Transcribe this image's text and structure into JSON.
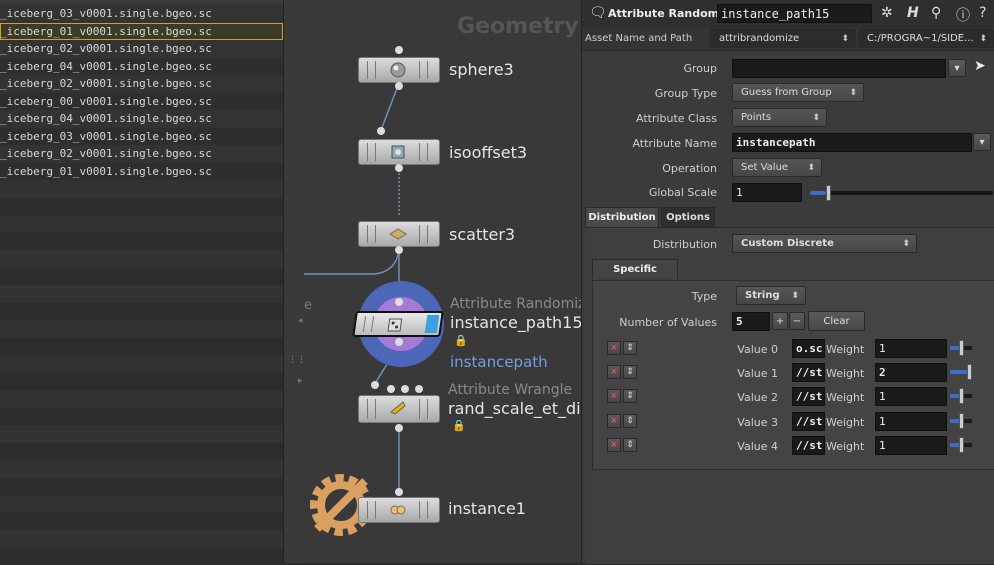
{
  "file_list": {
    "rows": [
      "_iceberg_03_v0001.single.bgeo.sc",
      "_iceberg_01_v0001.single.bgeo.sc",
      "_iceberg_02_v0001.single.bgeo.sc",
      "_iceberg_04_v0001.single.bgeo.sc",
      "_iceberg_02_v0001.single.bgeo.sc",
      "_iceberg_00_v0001.single.bgeo.sc",
      "_iceberg_04_v0001.single.bgeo.sc",
      "_iceberg_03_v0001.single.bgeo.sc",
      "_iceberg_02_v0001.single.bgeo.sc",
      "_iceberg_01_v0001.single.bgeo.sc"
    ],
    "selected_index": 1
  },
  "network": {
    "context_label": "Geometry",
    "side_letter": "e",
    "nodes": [
      {
        "name": "sphere3",
        "type": "",
        "icon": "sphere-icon"
      },
      {
        "name": "isooffset3",
        "type": "",
        "icon": "isooffset-icon"
      },
      {
        "name": "scatter3",
        "type": "",
        "icon": "scatter-icon"
      },
      {
        "name": "instance_path15",
        "type": "Attribute Randomize",
        "icon": "attribute-randomize-icon",
        "sublabel": "instancepath"
      },
      {
        "name": "rand_scale_et_dir",
        "type": "Attribute Wrangle",
        "icon": "wrangle-icon"
      },
      {
        "name": "instance1",
        "type": "",
        "icon": "instance-icon"
      }
    ]
  },
  "params": {
    "title": {
      "type_name": "Attribute Randomize",
      "node_name": "instance_path15"
    },
    "asset": {
      "label": "Asset Name and Path",
      "name": "attribrandomize",
      "path": "C:/PROGRA~1/SIDE..."
    },
    "group": {
      "label": "Group",
      "value": ""
    },
    "group_type": {
      "label": "Group Type",
      "value": "Guess from Group"
    },
    "attribute_class": {
      "label": "Attribute Class",
      "value": "Points"
    },
    "attribute_name": {
      "label": "Attribute Name",
      "value": "instancepath"
    },
    "operation": {
      "label": "Operation",
      "value": "Set Value"
    },
    "global_scale": {
      "label": "Global Scale",
      "value": "1",
      "slider_fraction": 0.09
    },
    "tabs": [
      "Distribution",
      "Options"
    ],
    "distribution": {
      "label": "Distribution",
      "value": "Custom Discrete"
    },
    "subtab": "Specific Values",
    "type": {
      "label": "Type",
      "value": "String"
    },
    "num_values": {
      "label": "Number of Values",
      "value": "5",
      "clear_label": "Clear"
    },
    "value_rows": [
      {
        "label": "Value 0",
        "value": "o.sc",
        "weight_label": "Weight",
        "weight": "1",
        "fraction": 0.5
      },
      {
        "label": "Value 1",
        "value": "//st",
        "weight_label": "Weight",
        "weight": "2",
        "fraction": 1.0
      },
      {
        "label": "Value 2",
        "value": "//st",
        "weight_label": "Weight",
        "weight": "1",
        "fraction": 0.5
      },
      {
        "label": "Value 3",
        "value": "//st",
        "weight_label": "Weight",
        "weight": "1",
        "fraction": 0.5
      },
      {
        "label": "Value 4",
        "value": "//st",
        "weight_label": "Weight",
        "weight": "1",
        "fraction": 0.5
      }
    ]
  },
  "colors": {
    "selection_outline": "#c9a23c",
    "slider_fill": "#3a6ec8",
    "halo_outer": "#4d67b8",
    "halo_inner": "#a57ad4"
  }
}
